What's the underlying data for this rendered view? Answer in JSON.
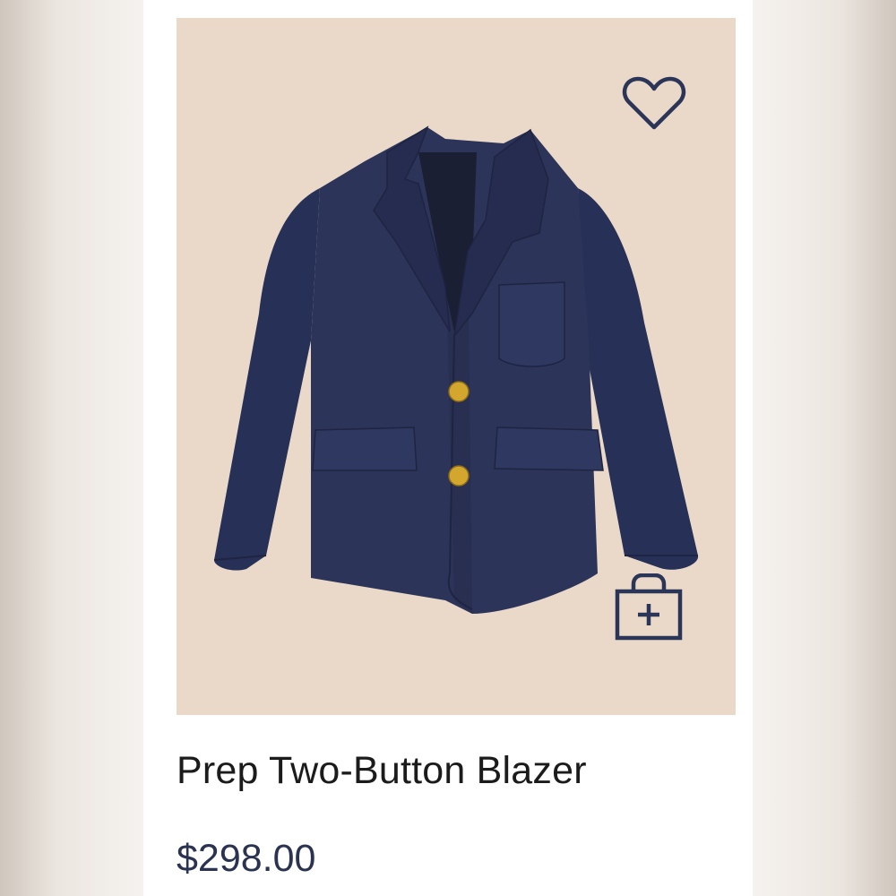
{
  "product": {
    "name": "Prep Two-Button Blazer",
    "price": "$298.00",
    "image_icon": "navy-blazer-image"
  },
  "actions": {
    "wishlist_icon": "heart-outline-icon",
    "add_to_bag_icon": "shopping-bag-plus-icon"
  },
  "colors": {
    "image_background": "#ead9c9",
    "icon_stroke": "#2b3557",
    "price_text": "#2a3350",
    "name_text": "#1b1b1b",
    "blazer_navy": "#2a3158",
    "button_gold": "#d3a62e"
  }
}
